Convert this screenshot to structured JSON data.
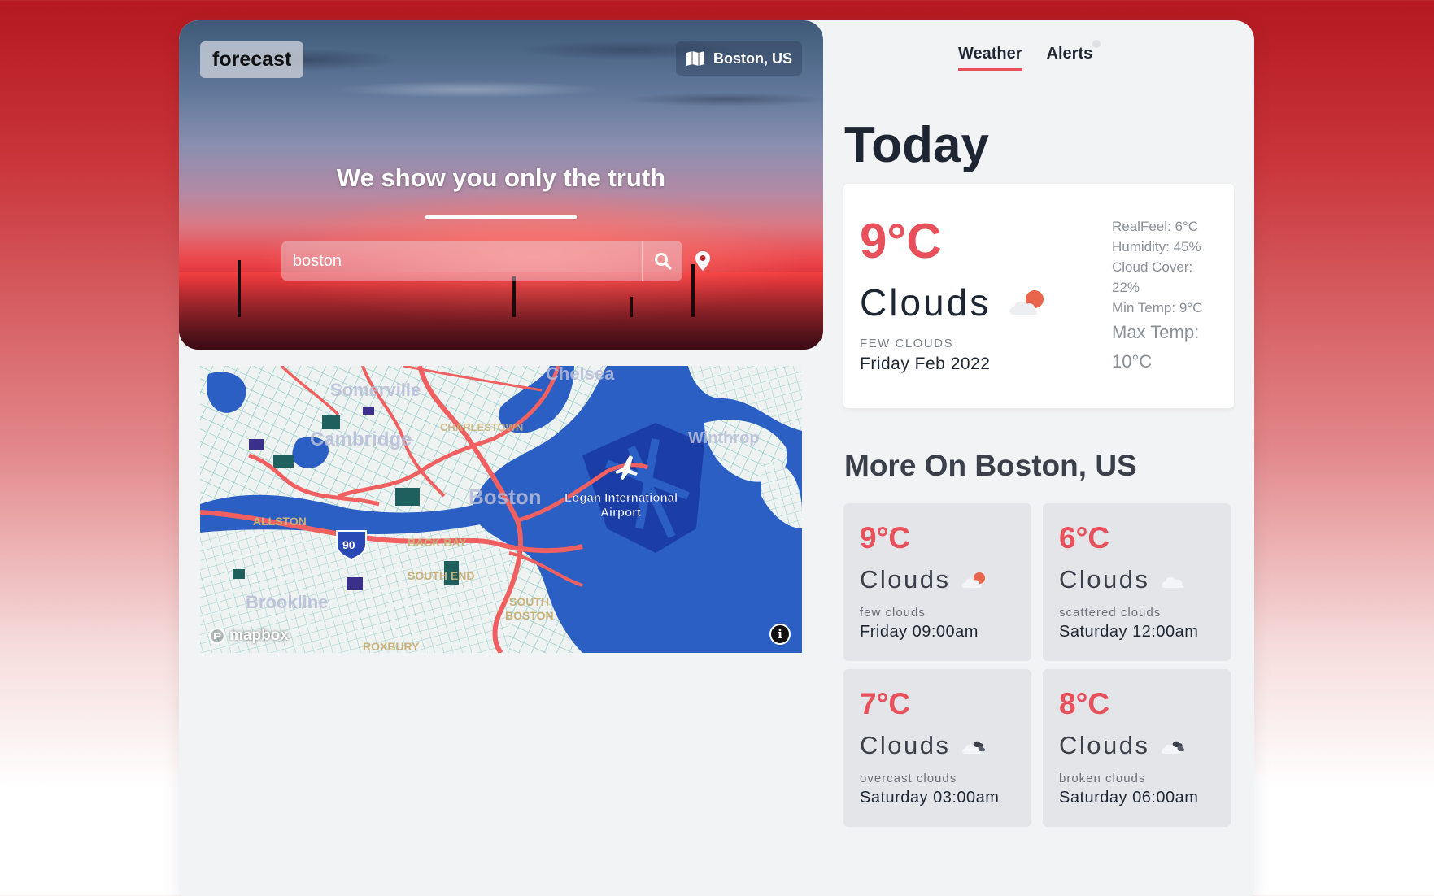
{
  "header": {
    "logo": "forecast",
    "location": "Boston, US",
    "location_icon": "map-icon",
    "tagline": "We show you only the truth"
  },
  "search": {
    "value": "boston",
    "search_icon": "search-icon",
    "pin_icon": "location-pin-icon"
  },
  "map": {
    "attribution": "mapbox",
    "labels": [
      "Somerville",
      "Chelsea",
      "Cambridge",
      "CHARLESTOWN",
      "Winthrop",
      "Boston",
      "Logan International",
      "Airport",
      "ALLSTON",
      "BACK BAY",
      "SOUTH END",
      "SOUTH",
      "BOSTON",
      "Brookline",
      "ROXBURY",
      "90"
    ],
    "info_icon": "info-icon"
  },
  "tabs": [
    {
      "label": "Weather",
      "active": true
    },
    {
      "label": "Alerts",
      "active": false
    }
  ],
  "today": {
    "title": "Today",
    "temp": "9°C",
    "condition": "Clouds",
    "description": "FEW CLOUDS",
    "date": "Friday Feb 2022",
    "icon": "few-clouds-icon",
    "stats": {
      "realfeel": "RealFeel: 6°C",
      "humidity": "Humidity: 45%",
      "cloud_cover": "Cloud Cover: 22%",
      "min_temp": "Min Temp: 9°C",
      "max_temp": "Max Temp: 10°C"
    }
  },
  "more": {
    "title": "More On Boston, US",
    "forecasts": [
      {
        "temp": "9°C",
        "condition": "Clouds",
        "description": "few clouds",
        "time": "Friday 09:00am",
        "icon": "few-clouds-icon"
      },
      {
        "temp": "6°C",
        "condition": "Clouds",
        "description": "scattered clouds",
        "time": "Saturday 12:00am",
        "icon": "scattered-clouds-icon"
      },
      {
        "temp": "7°C",
        "condition": "Clouds",
        "description": "overcast clouds",
        "time": "Saturday 03:00am",
        "icon": "overcast-clouds-icon"
      },
      {
        "temp": "8°C",
        "condition": "Clouds",
        "description": "broken clouds",
        "time": "Saturday 06:00am",
        "icon": "broken-clouds-icon"
      }
    ]
  },
  "colors": {
    "accent": "#e8505b",
    "text_dark": "#1f2633",
    "card_bg": "#e4e5e9",
    "map_water": "#2b5fc4",
    "map_roads": "#f06060"
  }
}
